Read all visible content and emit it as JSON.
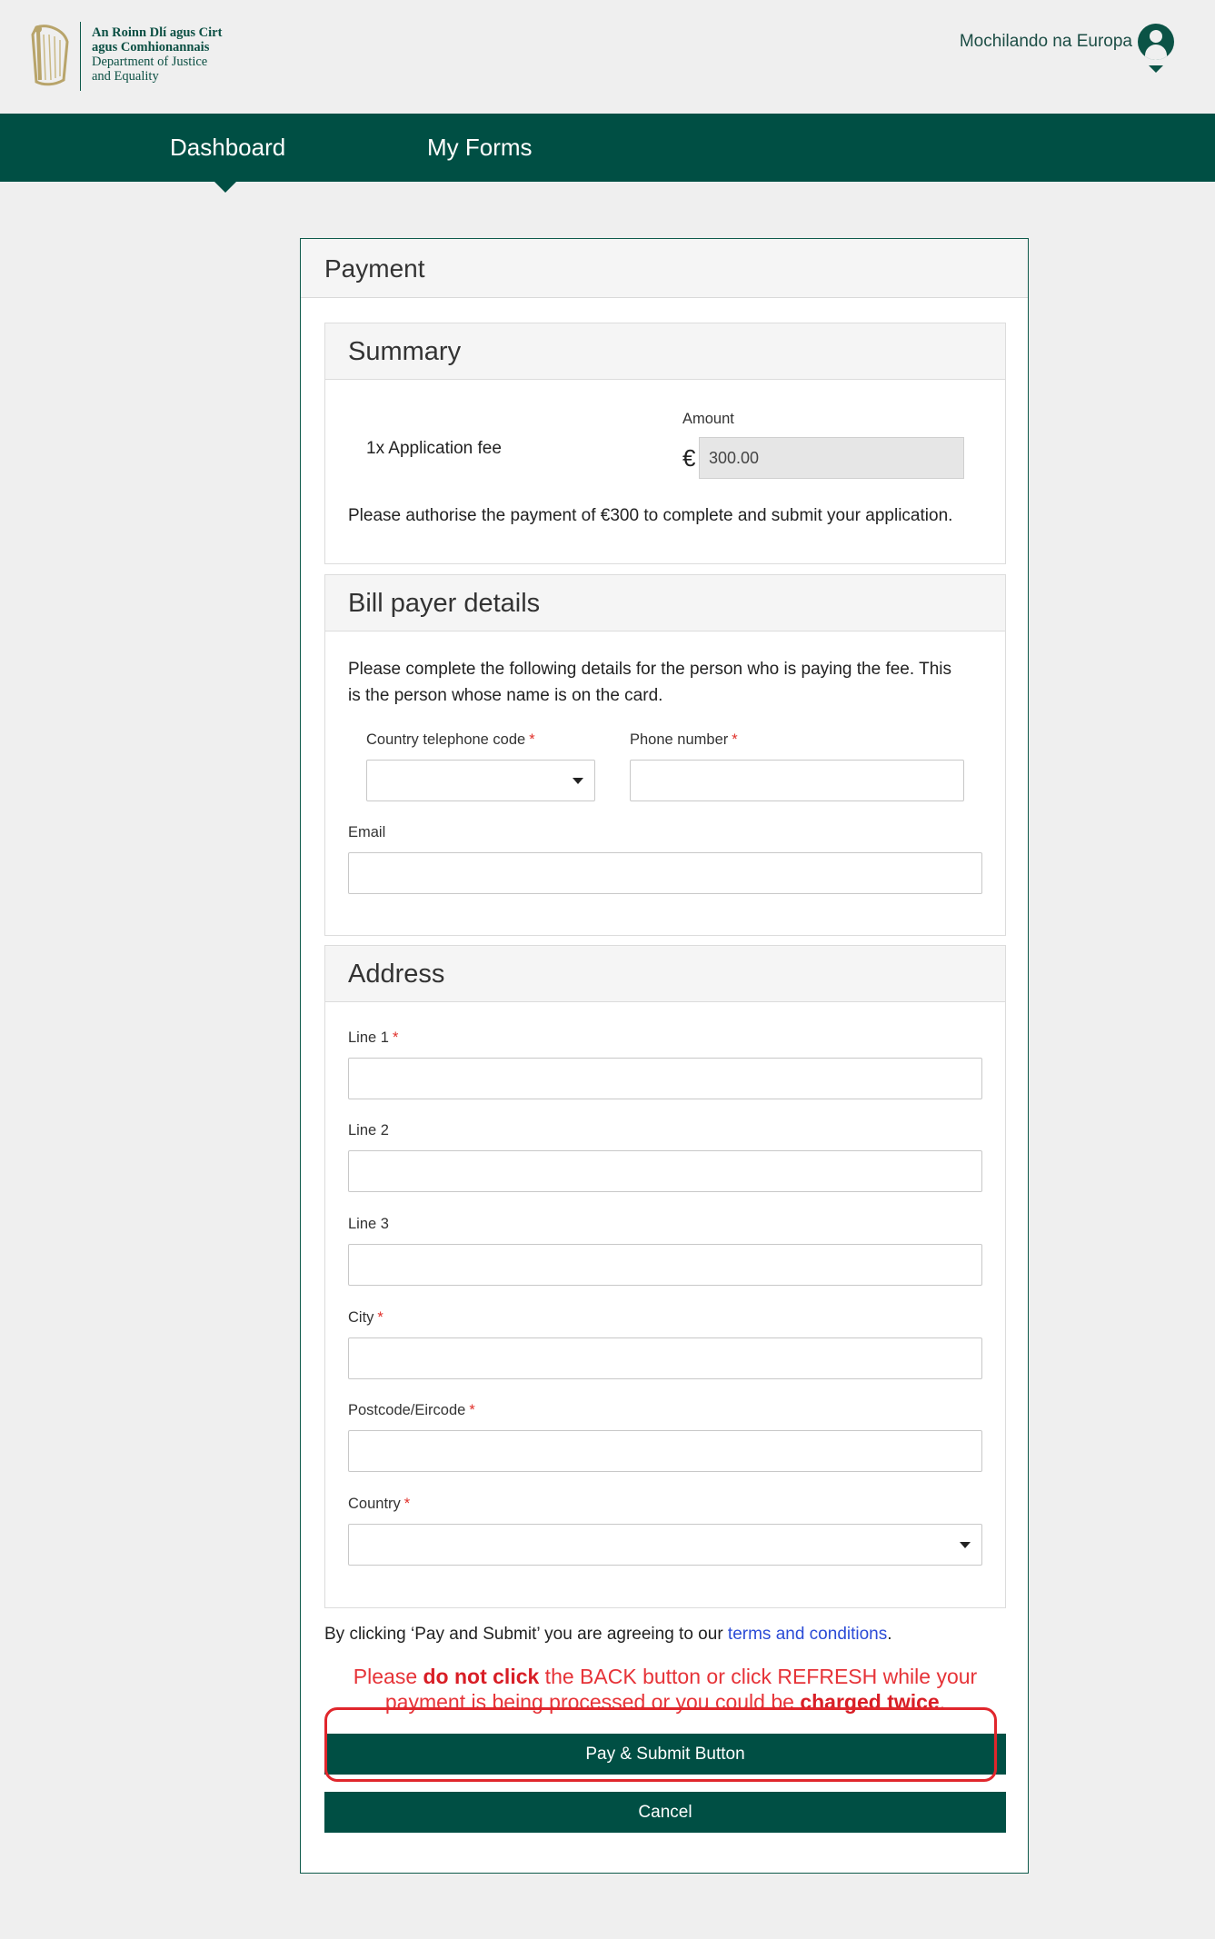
{
  "header": {
    "logo_lines": [
      "An Roinn Dlí agus Cirt",
      "agus Comhionannais",
      "Department of Justice",
      "and Equality"
    ],
    "user_name": "Mochilando na Europa"
  },
  "nav": {
    "dashboard": "Dashboard",
    "my_forms": "My Forms"
  },
  "payment": {
    "title": "Payment",
    "summary": {
      "title": "Summary",
      "item": "1x Application fee",
      "amount_label": "Amount",
      "currency_symbol": "€",
      "amount_value": "300.00",
      "note": "Please authorise the payment of €300 to complete and submit your application."
    },
    "bill_payer": {
      "title": "Bill payer details",
      "intro_line1": "Please complete the following details for the person who is paying the fee. This",
      "intro_line2": "is the person whose name is on the card.",
      "country_code_label": "Country telephone code",
      "phone_label": "Phone number",
      "email_label": "Email",
      "required_mark": "*"
    },
    "address": {
      "title": "Address",
      "line1_label": "Line 1",
      "line2_label": "Line 2",
      "line3_label": "Line 3",
      "city_label": "City",
      "postcode_label": "Postcode/Eircode",
      "country_label": "Country",
      "required_mark": "*"
    },
    "terms_prefix": "By clicking ‘Pay and Submit’ you are agreeing to our ",
    "terms_link": "terms and conditions",
    "terms_suffix": ".",
    "warning": {
      "part1": "Please ",
      "strong1": "do not click",
      "part2": " the BACK button or click REFRESH while your payment is being processed or you could be ",
      "strong2": "charged twice",
      "part3": "."
    },
    "pay_button": "Pay & Submit Button",
    "cancel_button": "Cancel"
  },
  "colors": {
    "brand_green": "#004f44",
    "required_red": "#e0302a",
    "warning_red": "#e63338",
    "link_blue": "#2b4bd6"
  },
  "icons": {
    "logo": "harp-icon",
    "user": "user-avatar-icon",
    "dropdown": "caret-down-icon"
  }
}
